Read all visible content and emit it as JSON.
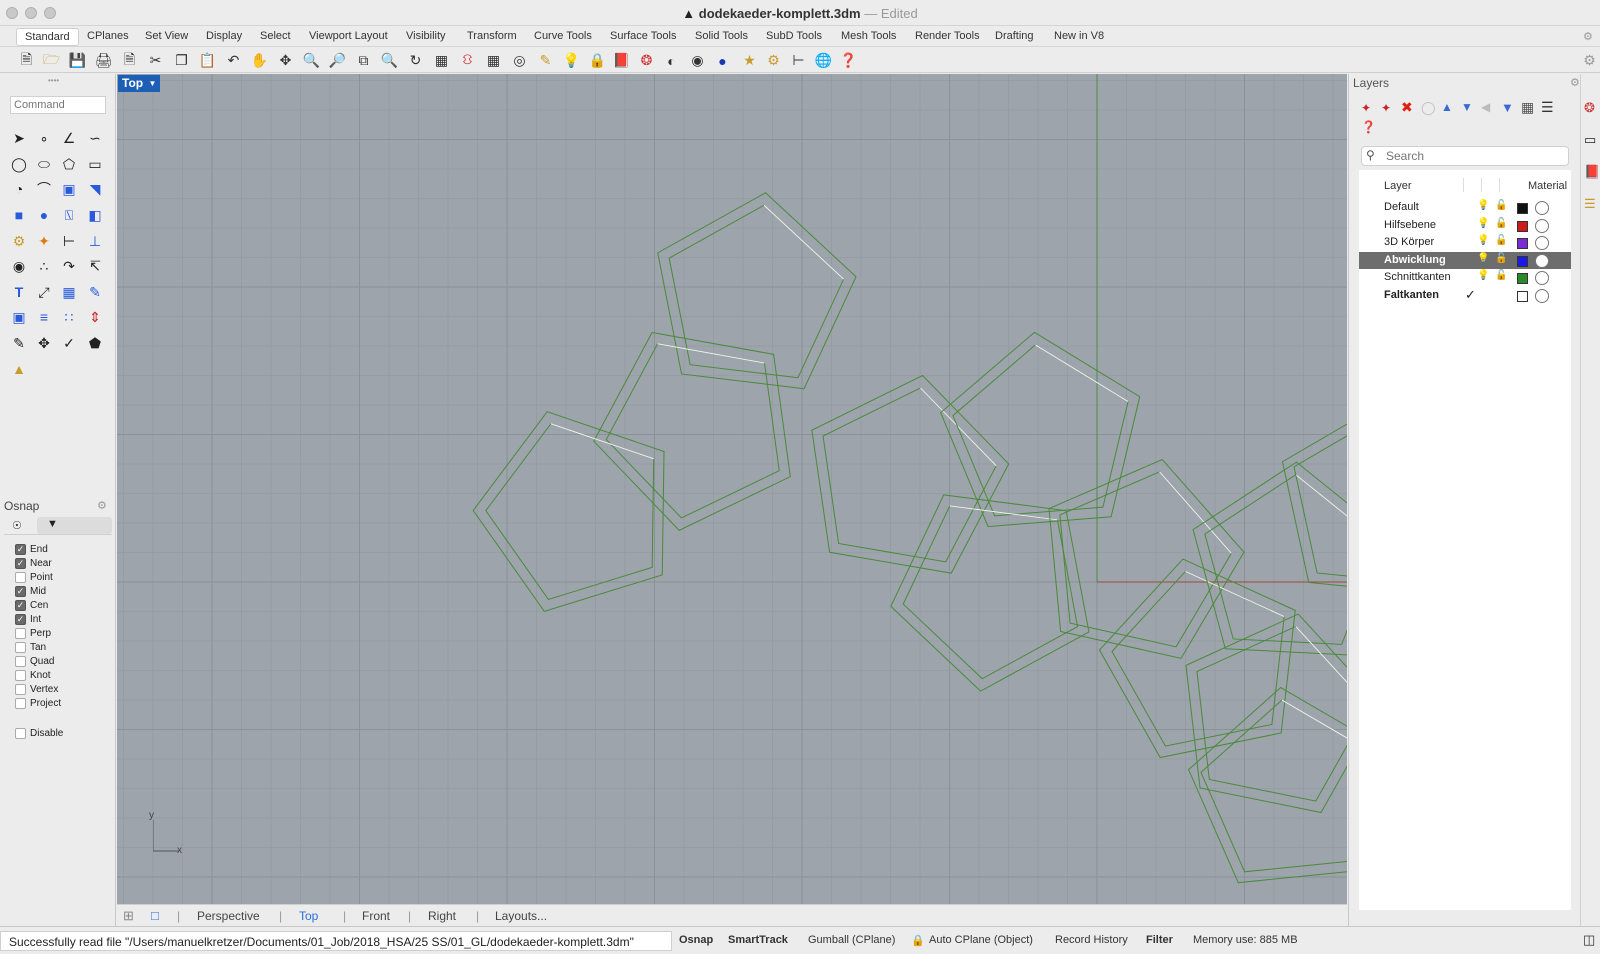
{
  "window": {
    "file_name": "dodekaeder-komplett.3dm",
    "separator": "—",
    "edited": "Edited"
  },
  "tabs": [
    "Standard",
    "CPlanes",
    "Set View",
    "Display",
    "Select",
    "Viewport Layout",
    "Visibility",
    "Transform",
    "Curve Tools",
    "Surface Tools",
    "Solid Tools",
    "SubD Tools",
    "Mesh Tools",
    "Render Tools",
    "Drafting",
    "New in V8"
  ],
  "command": {
    "placeholder": "Command"
  },
  "osnap": {
    "title": "Osnap",
    "items": [
      {
        "label": "End",
        "checked": true
      },
      {
        "label": "Near",
        "checked": true
      },
      {
        "label": "Point",
        "checked": false
      },
      {
        "label": "Mid",
        "checked": true
      },
      {
        "label": "Cen",
        "checked": true
      },
      {
        "label": "Int",
        "checked": true
      },
      {
        "label": "Perp",
        "checked": false
      },
      {
        "label": "Tan",
        "checked": false
      },
      {
        "label": "Quad",
        "checked": false
      },
      {
        "label": "Knot",
        "checked": false
      },
      {
        "label": "Vertex",
        "checked": false
      },
      {
        "label": "Project",
        "checked": false
      }
    ],
    "disable_label": "Disable"
  },
  "viewport": {
    "label": "Top",
    "axis_y": "y",
    "axis_x": "x"
  },
  "viewport_tabs": [
    "Perspective",
    "Top",
    "Front",
    "Right",
    "Layouts..."
  ],
  "layers": {
    "title": "Layers",
    "search_placeholder": "Search",
    "col_layer": "Layer",
    "col_material": "Material",
    "rows": [
      {
        "name": "Default",
        "color": "#111111",
        "selected": false
      },
      {
        "name": "Hilfsebene",
        "color": "#cc1b1b",
        "selected": false
      },
      {
        "name": "3D Körper",
        "color": "#7a2bd6",
        "selected": false
      },
      {
        "name": "Abwicklung",
        "color": "#1a1ae6",
        "selected": true
      },
      {
        "name": "Schnittkanten",
        "color": "#2a8a2a",
        "selected": false
      },
      {
        "name": "Faltkanten",
        "color": "#ffffff",
        "selected": false,
        "current": true
      }
    ]
  },
  "status": {
    "message": "Successfully read file \"/Users/manuelkretzer/Documents/01_Job/2018_HSA/25 SS/01_GL/dodekaeder-komplett.3dm\"",
    "osnap": "Osnap",
    "smarttrack": "SmartTrack",
    "gumball": "Gumball (CPlane)",
    "autocplane": "Auto CPlane (Object)",
    "record_history": "Record History",
    "filter": "Filter",
    "memory": "Memory use: 885 MB"
  },
  "colors": {
    "viewport_bg": "#9da4ac",
    "cut_edge": "#4a8a3a",
    "fold_edge": "#f2f2f2",
    "accent": "#1c5fb5"
  }
}
